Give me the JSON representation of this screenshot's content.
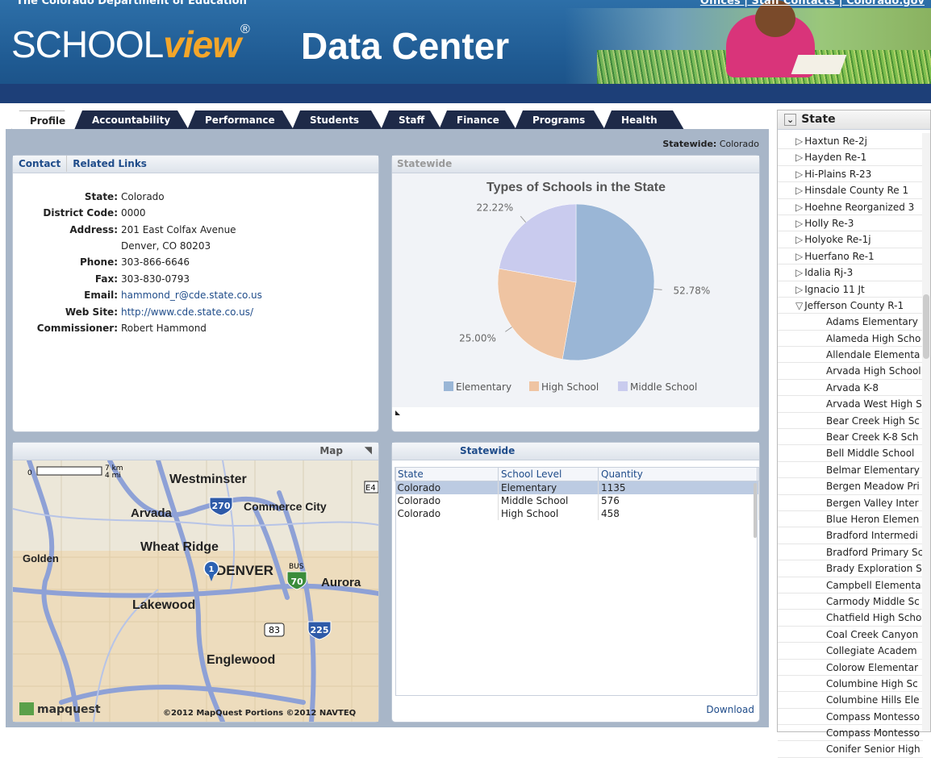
{
  "header": {
    "topline": "The Colorado Department of Education",
    "toplinks": "Offices  |  Staff Contacts  |  Colorado.gov",
    "logo_school": "SCHOOL",
    "logo_view": "view",
    "logo_reg": "®",
    "app_title": "Data Center"
  },
  "tabs": [
    "Profile",
    "Accountability",
    "Performance",
    "Students",
    "Staff",
    "Finance",
    "Programs",
    "Health"
  ],
  "statewide_label": "Statewide:",
  "statewide_value": "Colorado",
  "contact": {
    "tab_contact": "Contact",
    "tab_links": "Related Links",
    "fields": [
      {
        "k": "State:",
        "v": "Colorado"
      },
      {
        "k": "District Code:",
        "v": "0000"
      },
      {
        "k": "Address:",
        "v": "201 East Colfax Avenue"
      },
      {
        "k": "",
        "v": "Denver, CO 80203"
      },
      {
        "k": "Phone:",
        "v": "303-866-6646"
      },
      {
        "k": "Fax:",
        "v": "303-830-0793"
      },
      {
        "k": "Email:",
        "v": "hammond_r@cde.state.co.us"
      },
      {
        "k": "Web Site:",
        "v": "http://www.cde.state.co.us/"
      },
      {
        "k": "Commissioner:",
        "v": "Robert Hammond"
      }
    ]
  },
  "chart_panel_title": "Statewide",
  "chart_data": {
    "type": "pie",
    "title": "Types of Schools in the State",
    "categories": [
      "Elementary",
      "High School",
      "Middle School"
    ],
    "values": [
      52.78,
      25.0,
      22.22
    ],
    "labels": [
      "52.78%",
      "25.00%",
      "22.22%"
    ],
    "colors": [
      "#9ab6d6",
      "#efc4a2",
      "#c9cbee"
    ],
    "legend": "bottom"
  },
  "map": {
    "title": "Map",
    "scale_km": "7 km",
    "scale_mi": "4 mi",
    "scale_zero": "0",
    "places": [
      "Westminster",
      "Arvada",
      "Commerce City",
      "Wheat Ridge",
      "Golden",
      "DENVER",
      "Aurora",
      "Lakewood",
      "Englewood"
    ],
    "shields": [
      "270",
      "70",
      "83",
      "225",
      "E4"
    ],
    "bus_label": "BUS",
    "copyright": "©2012 MapQuest  Portions ©2012 NAVTEQ",
    "brand": "mapquest"
  },
  "table": {
    "title": "Statewide",
    "columns": [
      "State",
      "School Level",
      "Quantity"
    ],
    "rows": [
      [
        "Colorado",
        "Elementary",
        "1135"
      ],
      [
        "Colorado",
        "Middle School",
        "576"
      ],
      [
        "Colorado",
        "High School",
        "458"
      ]
    ],
    "download": "Download"
  },
  "state_panel": {
    "title": "State",
    "districts": [
      "Haxtun Re-2j",
      "Hayden Re-1",
      "Hi-Plains R-23",
      "Hinsdale County Re 1",
      "Hoehne Reorganized 3",
      "Holly Re-3",
      "Holyoke Re-1j",
      "Huerfano Re-1",
      "Idalia Rj-3",
      "Ignacio 11 Jt",
      "Jefferson County R-1"
    ],
    "schools": [
      "Adams Elementary",
      "Alameda High Scho",
      "Allendale Elementa",
      "Arvada High School",
      "Arvada K-8",
      "Arvada West High S",
      "Bear Creek High Sc",
      "Bear Creek K-8 Sch",
      "Bell Middle School",
      "Belmar Elementary",
      "Bergen Meadow Pri",
      "Bergen Valley Inter",
      "Blue Heron Elemen",
      "Bradford Intermedi",
      "Bradford Primary Sc",
      "Brady Exploration S",
      "Campbell Elementa",
      "Carmody Middle Sc",
      "Chatfield High Scho",
      "Coal Creek Canyon",
      "Collegiate Academ",
      "Colorow Elementar",
      "Columbine High Sc",
      "Columbine Hills Ele",
      "Compass Montesso",
      "Compass Montesso",
      "Conifer Senior High"
    ]
  }
}
